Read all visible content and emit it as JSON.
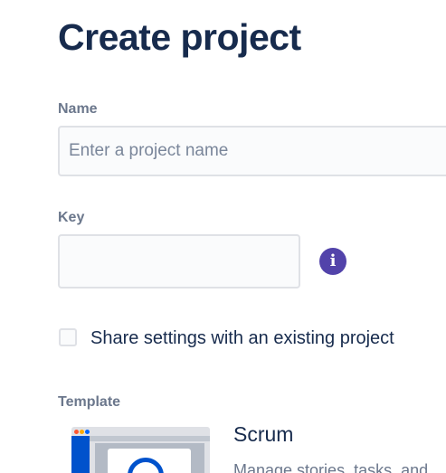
{
  "page": {
    "title": "Create project"
  },
  "form": {
    "name": {
      "label": "Name",
      "value": "",
      "placeholder": "Enter a project name"
    },
    "key": {
      "label": "Key",
      "value": "",
      "info_icon": "info-icon"
    },
    "share_settings": {
      "label": "Share settings with an existing project",
      "checked": false
    }
  },
  "template": {
    "label": "Template",
    "selected": {
      "name": "Scrum",
      "description": "Manage stories, tasks, and",
      "thumbnail_dot_colors": [
        "#FF5630",
        "#FFAB00",
        "#0065FF"
      ]
    }
  },
  "colors": {
    "heading": "#172B4D",
    "label": "#6B778C",
    "info_icon": "#5243AA",
    "input_border": "#DFE1E6",
    "brand_blue": "#0052CC"
  }
}
